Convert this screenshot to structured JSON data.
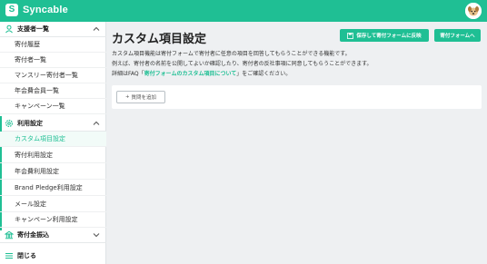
{
  "app": {
    "logo_text": "Syncable",
    "logo_mark": "S"
  },
  "sidebar": {
    "sections": [
      {
        "label": "支援者一覧",
        "icon": "person-icon"
      },
      {
        "label": "利用設定",
        "icon": "gear-icon"
      },
      {
        "label": "寄付金振込",
        "icon": "bank-icon"
      },
      {
        "label": "閉じる",
        "icon": "menu-icon"
      }
    ],
    "supporters_items": [
      "寄付履歴",
      "寄付者一覧",
      "マンスリー寄付者一覧",
      "年会費会員一覧",
      "キャンペーン一覧"
    ],
    "settings_items": [
      "カスタム項目設定",
      "寄付利用設定",
      "年会費利用設定",
      "Brand Pledge利用設定",
      "メール設定",
      "キャンペーン利用設定"
    ]
  },
  "main": {
    "title": "カスタム項目設定",
    "save_button": "保存して寄付フォームに反映",
    "form_button": "寄付フォームへ",
    "desc_line1": "カスタム項目機能は寄付フォームで寄付者に任意の項目を回答してもらうことができる機能です。",
    "desc_line2": "例えば、寄付者の名前を公開してよいか確認したり、寄付者の反社事項に同意してもらうことができます。",
    "desc_line3_prefix": "詳細はFAQ「",
    "desc_line3_link": "寄付フォームのカスタム項目について",
    "desc_line3_suffix": "」をご確認ください。",
    "add_question_button": "質問を追加",
    "add_icon": "+"
  },
  "colors": {
    "brand": "#1fbf94",
    "background": "#eef0f2"
  }
}
